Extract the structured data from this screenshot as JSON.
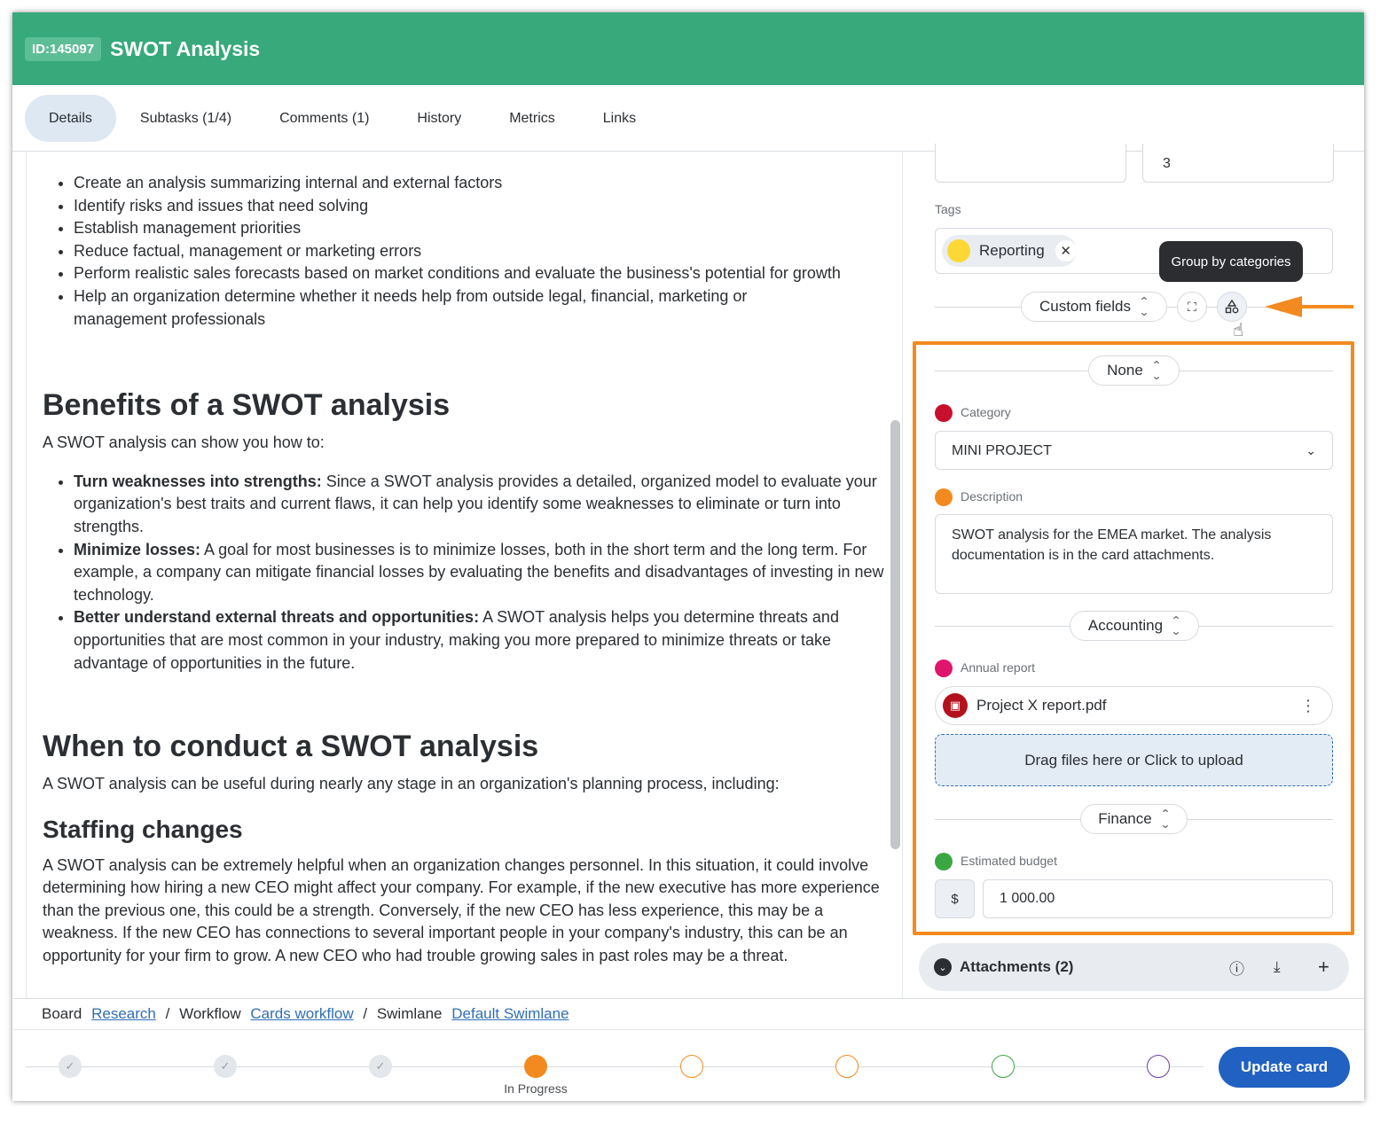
{
  "header": {
    "id_badge": "ID:145097",
    "title": "SWOT Analysis"
  },
  "tabs": [
    {
      "label": "Details",
      "active": true
    },
    {
      "label": "Subtasks (1/4)"
    },
    {
      "label": "Comments (1)"
    },
    {
      "label": "History"
    },
    {
      "label": "Metrics"
    },
    {
      "label": "Links"
    }
  ],
  "content": {
    "bullets_top": [
      "Create an analysis summarizing internal and external factors",
      "Identify risks and issues that need solving",
      "Establish management priorities",
      "Reduce factual, management or marketing errors",
      "Perform realistic sales forecasts based on market conditions and evaluate the business's potential for growth",
      "Help an organization determine whether it needs help from outside legal, financial, marketing or management professionals"
    ],
    "benefits_heading": "Benefits of a SWOT analysis",
    "benefits_intro": "A SWOT analysis can show you how to:",
    "benefits": [
      {
        "bold": "Turn weaknesses into strengths:",
        "text": " Since a SWOT analysis provides a detailed, organized model to evaluate your organization's best traits and current flaws, it can help you identify some weaknesses to eliminate or turn into strengths."
      },
      {
        "bold": "Minimize losses:",
        "text": " A goal for most businesses is to minimize losses, both in the short term and the long term. For example, a company can mitigate financial losses by evaluating the benefits and disadvantages of investing in new technology."
      },
      {
        "bold": "Better understand external threats and opportunities:",
        "text": " A SWOT analysis helps you determine threats and opportunities that are most common in your industry, making you more prepared to minimize threats or take advantage of opportunities in the future."
      }
    ],
    "when_heading": "When to conduct a SWOT analysis",
    "when_intro": "A SWOT analysis can be useful during nearly any stage in an organization's planning process, including:",
    "staffing_heading": "Staffing changes",
    "staffing_text": "A SWOT analysis can be extremely helpful when an organization changes personnel. In this situation, it could involve determining how hiring a new CEO might affect your company. For example, if the new executive has more experience than the previous one, this could be a strength. Conversely, if the new CEO has less experience, this may be a weakness. If the new CEO has connections to several important people in your company's industry, this can be an opportunity for your firm to grow. A new CEO who had trouble growing sales in past roles may be a threat."
  },
  "panel": {
    "top_field_value": "3",
    "tags_label": "Tags",
    "tag": {
      "label": "Reporting",
      "color": "#fdd835"
    },
    "tooltip": "Group by categories",
    "custom_fields_label": "Custom fields",
    "group_none": "None",
    "category_label": "Category",
    "category_value": "MINI PROJECT",
    "description_label": "Description",
    "description_value": "SWOT analysis for the EMEA market. The analysis documentation is in the card attachments.",
    "group_accounting": "Accounting",
    "annual_report_label": "Annual report",
    "file_name": "Project X report.pdf",
    "upload_text": "Drag files here or Click to upload",
    "group_finance": "Finance",
    "budget_label": "Estimated budget",
    "currency": "$",
    "budget_value": "1 000.00",
    "attachments_label": "Attachments (2)",
    "colors": {
      "category": "#c8102e",
      "description": "#f28a1f",
      "annual_report": "#e0156c",
      "budget": "#3aa743"
    }
  },
  "footer": {
    "board_label": "Board",
    "board_link": "Research",
    "workflow_label": "Workflow",
    "workflow_link": "Cards workflow",
    "swimlane_label": "Swimlane",
    "swimlane_link": "Default Swimlane",
    "current_step_label": "In Progress",
    "update_button": "Update card"
  }
}
